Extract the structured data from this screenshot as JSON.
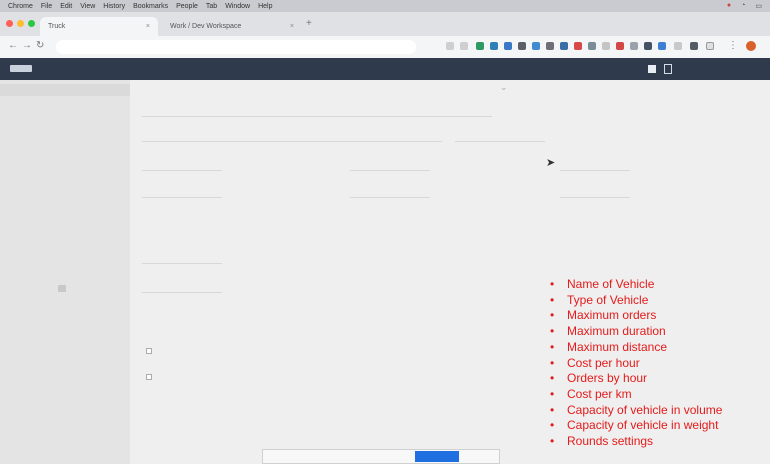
{
  "os_menubar": {
    "items": [
      "Chrome",
      "File",
      "Edit",
      "View",
      "History",
      "Bookmarks",
      "People",
      "Tab",
      "Window",
      "Help"
    ],
    "status": [
      "",
      "",
      ""
    ]
  },
  "browser": {
    "tabs": [
      {
        "title": "Truck",
        "active": true
      },
      {
        "title": "Work / Dev Workspace",
        "active": false
      }
    ],
    "url": "",
    "colors": {
      "chrome": "#dfe1e5",
      "accent": "#1f6fe0"
    }
  },
  "app": {
    "header_color": "#2f3b4d",
    "user_name": ""
  },
  "sidebar": {
    "items": [
      "",
      "",
      "",
      "",
      "",
      "",
      "",
      "",
      "",
      "",
      ""
    ],
    "add_button_label": ""
  },
  "form": {
    "fields": [],
    "sections": [],
    "checkboxes": []
  },
  "annotation": {
    "color": "#e41b1b",
    "items": [
      "Name of Vehicle",
      "Type of Vehicle",
      "Maximum orders",
      "Maximum duration",
      "Maximum distance",
      "Cost per hour",
      "Orders by hour",
      "Cost per km",
      "Capacity of vehicle in volume",
      "Capacity of vehicle in weight",
      "Rounds settings"
    ]
  },
  "cookie_banner": {
    "text": "",
    "accept_label": "",
    "more_label": ""
  }
}
